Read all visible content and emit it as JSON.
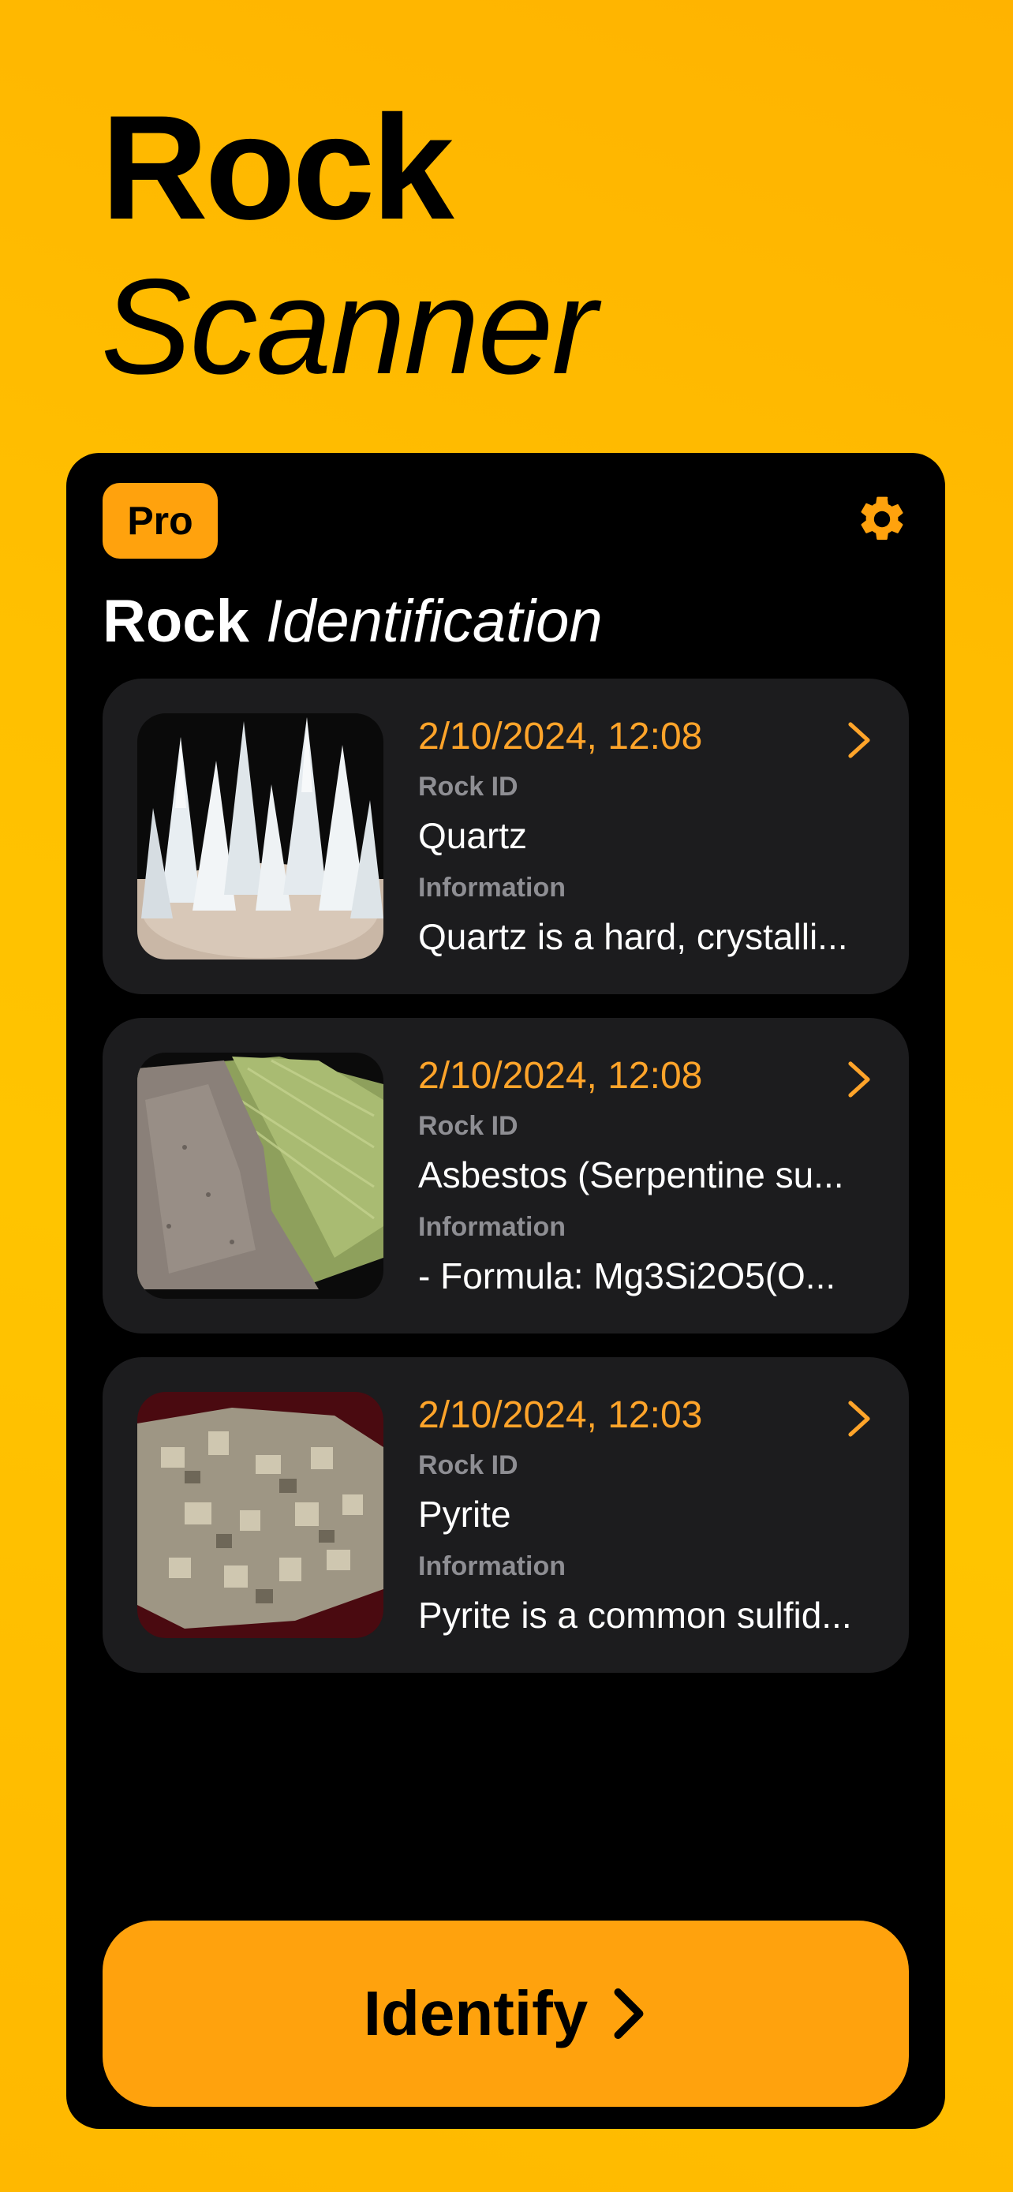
{
  "header": {
    "title_line1": "Rock",
    "title_line2": "Scanner"
  },
  "panel": {
    "pro_label": "Pro",
    "settings_icon": "gear-icon",
    "section_title_bold": "Rock",
    "section_title_italic": "Identification",
    "scans": [
      {
        "date": "2/10/2024, 12:08",
        "rock_id_label": "Rock ID",
        "rock_id": "Quartz",
        "info_label": "Information",
        "info": "Quartz is a hard, crystalli..."
      },
      {
        "date": "2/10/2024, 12:08",
        "rock_id_label": "Rock ID",
        "rock_id": "Asbestos (Serpentine su...",
        "info_label": "Information",
        "info": "- Formula: Mg3Si2O5(O..."
      },
      {
        "date": "2/10/2024, 12:03",
        "rock_id_label": "Rock ID",
        "rock_id": "Pyrite",
        "info_label": "Information",
        "info": "Pyrite is a common sulfid..."
      }
    ],
    "identify_label": "Identify"
  },
  "colors": {
    "accent": "#ffa20d",
    "date": "#ffa42a",
    "card": "#1c1c1e",
    "panel": "#000000"
  }
}
